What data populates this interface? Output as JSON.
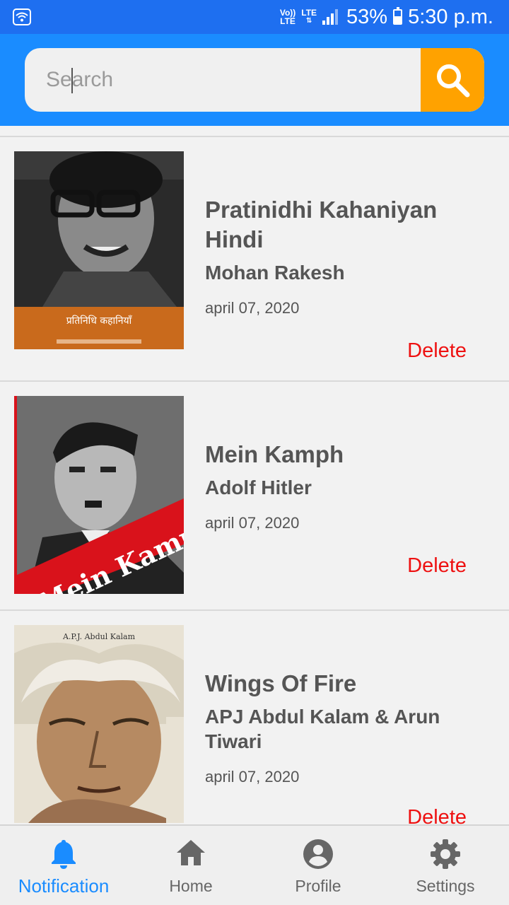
{
  "status_bar": {
    "volte": "Vo))\nLTE",
    "network": "LTE",
    "battery": "53%",
    "time": "5:30 p.m."
  },
  "search": {
    "placeholder": "Search",
    "value": ""
  },
  "books": [
    {
      "title": "Pratinidhi Kahaniyan Hindi",
      "author": "Mohan Rakesh",
      "date": "april 07, 2020",
      "delete_label": "Delete",
      "cover_text": "प्रतिनिधि कहानियाँ"
    },
    {
      "title": "Mein Kamph",
      "author": "Adolf Hitler",
      "date": "april 07, 2020",
      "delete_label": "Delete",
      "cover_text": "Mein Kampf"
    },
    {
      "title": "Wings Of Fire",
      "author": "APJ Abdul Kalam & Arun Tiwari",
      "date": "april 07, 2020",
      "delete_label": "Delete",
      "cover_text": "A.P.J. Abdul Kalam"
    }
  ],
  "nav": [
    {
      "label": "Notification",
      "icon": "bell-icon",
      "active": true
    },
    {
      "label": "Home",
      "icon": "home-icon",
      "active": false
    },
    {
      "label": "Profile",
      "icon": "account-circle-icon",
      "active": false
    },
    {
      "label": "Settings",
      "icon": "gear-icon",
      "active": false
    }
  ],
  "colors": {
    "header": "#1a8cff",
    "status_bar": "#1e6ff0",
    "search_button": "#ffa200",
    "delete": "#ee1111",
    "active_nav": "#1a8cff",
    "inactive_nav": "#666666"
  }
}
